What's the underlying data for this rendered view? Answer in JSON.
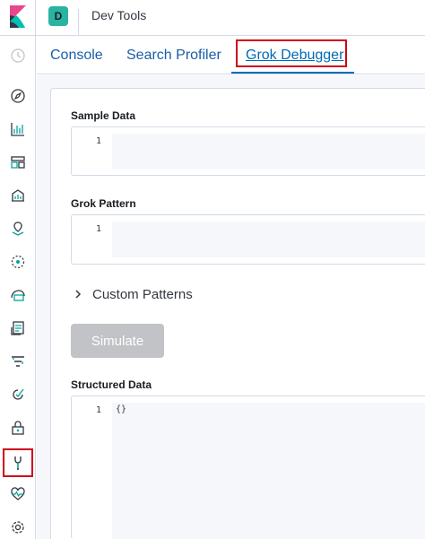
{
  "header": {
    "space_initial": "D",
    "app_title": "Dev Tools"
  },
  "sidebar": {
    "items": [
      {
        "icon": "clock-icon"
      },
      {
        "icon": "compass-icon"
      },
      {
        "icon": "visualize-icon"
      },
      {
        "icon": "dashboard-icon"
      },
      {
        "icon": "canvas-icon"
      },
      {
        "icon": "maps-icon"
      },
      {
        "icon": "ml-icon"
      },
      {
        "icon": "infrastructure-icon"
      },
      {
        "icon": "logs-icon"
      },
      {
        "icon": "apm-icon"
      },
      {
        "icon": "uptime-icon"
      },
      {
        "icon": "siem-icon"
      },
      {
        "icon": "devtools-icon",
        "active": true
      },
      {
        "icon": "monitoring-icon"
      },
      {
        "icon": "gear-icon"
      }
    ]
  },
  "tabs": [
    {
      "label": "Console"
    },
    {
      "label": "Search Profiler"
    },
    {
      "label": "Grok Debugger",
      "selected": true
    }
  ],
  "sample_data": {
    "label": "Sample Data",
    "line_number": "1",
    "value": ""
  },
  "grok_pattern": {
    "label": "Grok Pattern",
    "line_number": "1",
    "value": ""
  },
  "custom_patterns": {
    "label": "Custom Patterns"
  },
  "simulate": {
    "label": "Simulate"
  },
  "structured_data": {
    "label": "Structured Data",
    "line_number": "1",
    "value": "{}"
  },
  "colors": {
    "accent": "#006bb8",
    "highlight": "#d0021b",
    "space_badge": "#2ab3a3",
    "disabled_button": "#c2c3c6"
  }
}
